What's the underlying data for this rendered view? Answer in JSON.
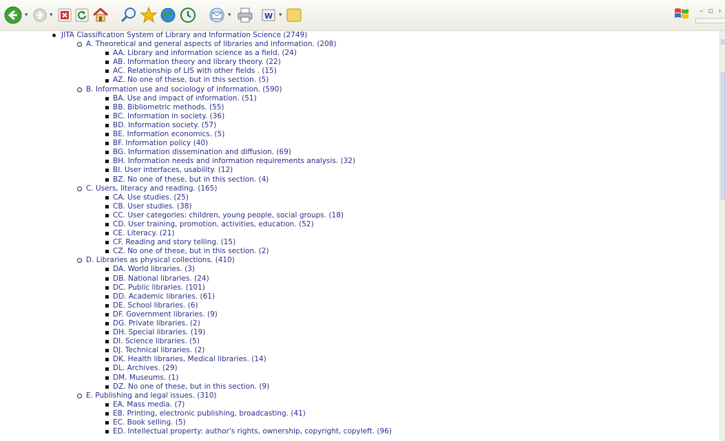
{
  "toolbar": {
    "buttons": [
      {
        "name": "back-button",
        "icon": "back-arrow-icon"
      },
      {
        "name": "forward-button",
        "icon": "forward-arrow-icon"
      },
      {
        "name": "stop-button",
        "icon": "stop-icon"
      },
      {
        "name": "refresh-button",
        "icon": "refresh-icon"
      },
      {
        "name": "home-button",
        "icon": "home-icon"
      },
      {
        "name": "search-button",
        "icon": "search-icon"
      },
      {
        "name": "favorites-button",
        "icon": "star-icon"
      },
      {
        "name": "media-button",
        "icon": "globe-icon"
      },
      {
        "name": "history-button",
        "icon": "history-icon"
      },
      {
        "name": "mail-button",
        "icon": "mail-icon"
      },
      {
        "name": "print-button",
        "icon": "printer-icon"
      },
      {
        "name": "edit-button",
        "icon": "word-icon"
      },
      {
        "name": "folder-button",
        "icon": "folder-icon"
      }
    ],
    "colors": {
      "back": "#3ea336",
      "stop": "#d3322a",
      "refresh": "#2e8b2e",
      "star": "#f2c200",
      "folder": "#f5d56a"
    }
  },
  "tree": {
    "label": "JITA Classification System of Library and Information Science (2749)",
    "sections": [
      {
        "label": "A. Theoretical and general aspects of libraries and information. (208)",
        "items": [
          "AA. Library and information science as a field. (24)",
          "AB. Information theory and library theory. (22)",
          "AC. Relationship of LIS with other fields . (15)",
          "AZ. No one of these, but in this section. (5)"
        ]
      },
      {
        "label": "B. Information use and sociology of information. (590)",
        "items": [
          "BA. Use and impact of information. (51)",
          "BB. Bibliometric methods. (55)",
          "BC. Information in society. (36)",
          "BD. Information society. (57)",
          "BE. Information economics. (5)",
          "BF. Information policy (40)",
          "BG. Information dissemination and diffusion. (69)",
          "BH. Information needs and information requirements analysis. (32)",
          "BI. User interfaces, usability. (12)",
          "BZ. No one of these, but in this section. (4)"
        ]
      },
      {
        "label": "C. Users, literacy and reading. (165)",
        "items": [
          "CA. Use studies. (25)",
          "CB. User studies. (38)",
          "CC. User categories: children, young people, social groups. (18)",
          "CD. User training, promotion, activities, education. (52)",
          "CE. Literacy. (21)",
          "CF. Reading and story telling. (15)",
          "CZ. No one of these, but in this section. (2)"
        ]
      },
      {
        "label": "D. Libraries as physical collections. (410)",
        "items": [
          "DA. World libraries. (3)",
          "DB. National libraries. (24)",
          "DC. Public libraries. (101)",
          "DD. Academic libraries. (61)",
          "DE. School libraries. (6)",
          "DF. Government libraries. (9)",
          "DG. Private libraries. (2)",
          "DH. Special libraries. (19)",
          "DI. Science libraries. (5)",
          "DJ. Technical libraries. (2)",
          "DK. Health libraries, Medical libraries. (14)",
          "DL. Archives. (29)",
          "DM. Museums. (1)",
          "DZ. No one of these, but in this section. (9)"
        ]
      },
      {
        "label": "E. Publishing and legal issues. (310)",
        "items": [
          "EA. Mass media. (7)",
          "EB. Printing, electronic publishing, broadcasting. (41)",
          "EC. Book selling. (5)",
          "ED. Intellectual property: author's rights, ownership, copyright, copyleft. (96)"
        ]
      }
    ]
  }
}
